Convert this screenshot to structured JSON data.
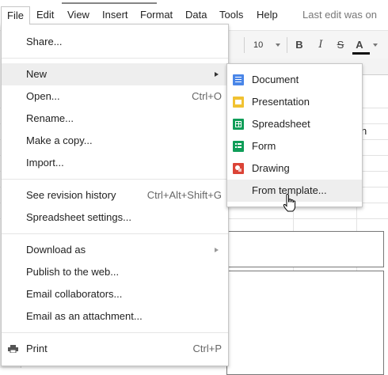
{
  "menubar": {
    "items": [
      "File",
      "Edit",
      "View",
      "Insert",
      "Format",
      "Data",
      "Tools",
      "Help"
    ],
    "last_edit": "Last edit was on"
  },
  "toolbar": {
    "font_size": "10",
    "bold": "B",
    "italic": "I",
    "strike": "S",
    "text_color": "A"
  },
  "sheet": {
    "cell_fragment": "n"
  },
  "file_menu": {
    "share": "Share...",
    "new": "New",
    "open": "Open...",
    "open_shortcut": "Ctrl+O",
    "rename": "Rename...",
    "make_copy": "Make a copy...",
    "import": "Import...",
    "revision_history": "See revision history",
    "revision_shortcut": "Ctrl+Alt+Shift+G",
    "spreadsheet_settings": "Spreadsheet settings...",
    "download_as": "Download as",
    "publish": "Publish to the web...",
    "email_collaborators": "Email collaborators...",
    "email_attachment": "Email as an attachment...",
    "print": "Print",
    "print_shortcut": "Ctrl+P"
  },
  "new_menu": {
    "document": "Document",
    "presentation": "Presentation",
    "spreadsheet": "Spreadsheet",
    "form": "Form",
    "drawing": "Drawing",
    "from_template": "From template..."
  },
  "colors": {
    "document": "#4a86e8",
    "presentation": "#f1c232",
    "spreadsheet": "#0f9d58",
    "form": "#0f9d58",
    "drawing": "#db4437",
    "hover": "#eeeeee"
  },
  "icons": {
    "print": "printer-icon",
    "new_arrow": "submenu-arrow-icon",
    "cursor": "hand-pointer-cursor"
  }
}
